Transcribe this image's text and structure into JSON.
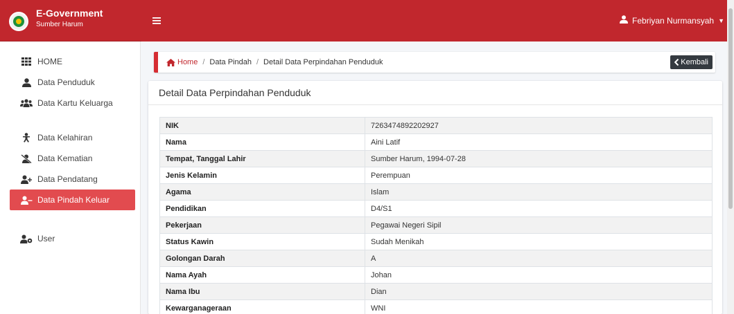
{
  "brand": {
    "title": "E-Government",
    "subtitle": "Sumber Harum"
  },
  "topbar": {
    "user_name": "Febriyan Nurmansyah"
  },
  "sidebar": {
    "items": [
      {
        "label": "HOME",
        "icon": "grid-icon"
      },
      {
        "label": "Data Penduduk",
        "icon": "user-icon"
      },
      {
        "label": "Data Kartu Keluarga",
        "icon": "users-icon"
      },
      {
        "label": "Data Kelahiran",
        "icon": "baby-icon"
      },
      {
        "label": "Data Kematian",
        "icon": "user-slash-icon"
      },
      {
        "label": "Data Pendatang",
        "icon": "user-plus-icon"
      },
      {
        "label": "Data Pindah Keluar",
        "icon": "user-minus-icon",
        "active": true
      },
      {
        "label": "User",
        "icon": "user-cog-icon"
      }
    ]
  },
  "breadcrumb": {
    "home": "Home",
    "level1": "Data Pindah",
    "level2": "Detail Data Perpindahan Penduduk",
    "back_label": "Kembali"
  },
  "card": {
    "title": "Detail Data Perpindahan Penduduk"
  },
  "details": [
    {
      "key": "NIK",
      "value": "7263474892202927"
    },
    {
      "key": "Nama",
      "value": "Aini Latif"
    },
    {
      "key": "Tempat, Tanggal Lahir",
      "value": "Sumber Harum, 1994-07-28"
    },
    {
      "key": "Jenis Kelamin",
      "value": "Perempuan"
    },
    {
      "key": "Agama",
      "value": "Islam"
    },
    {
      "key": "Pendidikan",
      "value": "D4/S1"
    },
    {
      "key": "Pekerjaan",
      "value": "Pegawai Negeri Sipil"
    },
    {
      "key": "Status Kawin",
      "value": "Sudah Menikah"
    },
    {
      "key": "Golongan Darah",
      "value": "A"
    },
    {
      "key": "Nama Ayah",
      "value": "Johan"
    },
    {
      "key": "Nama Ibu",
      "value": "Dian"
    },
    {
      "key": "Kewarganageraan",
      "value": "WNI"
    }
  ],
  "colors": {
    "primary": "#c1272d",
    "active": "#e24b4f",
    "dark_button": "#343a40"
  }
}
